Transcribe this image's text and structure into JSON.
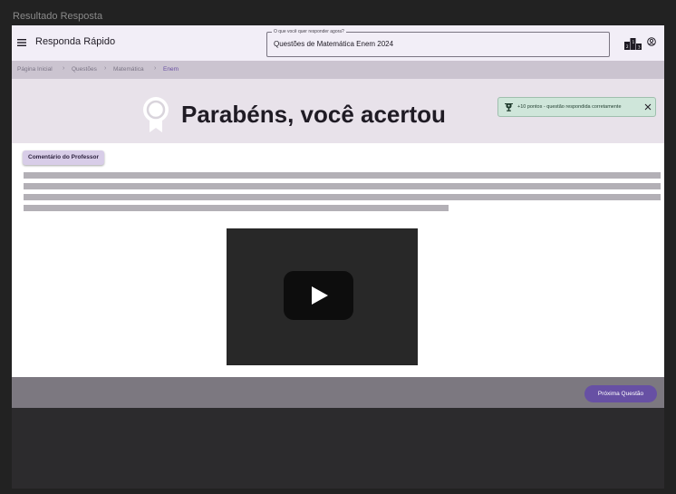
{
  "window": {
    "title": "Resultado Resposta"
  },
  "appbar": {
    "app_name": "Responda Rápido",
    "search": {
      "label": "O que você quer responder agora?",
      "value": "Questões de Matemática Enem 2024"
    }
  },
  "breadcrumb": {
    "items": [
      "Página Inicial",
      "Questões",
      "Matemática",
      "Enem"
    ],
    "separator": "›"
  },
  "hero": {
    "title": "Parabéns, você acertou"
  },
  "notification": {
    "text": "+10 pontos - questão respondida corretamente"
  },
  "content": {
    "teacher_comment_label": "Comentário do Professor",
    "comment_lines_fill": [
      1.0,
      1.0,
      1.0,
      0.67
    ]
  },
  "footer": {
    "next_label": "Próxima Questão"
  },
  "colors": {
    "accent": "#6750a4",
    "hero_bg": "#e8e2ea",
    "breadcrumb_bg": "#cbc4d0",
    "snackbar_bg": "#cfe6da",
    "video_bg": "#282828",
    "footer_bg": "#7c7880"
  },
  "icons": [
    "menu-icon",
    "ranking-podium-icon",
    "account-circle-icon",
    "medal-icon",
    "trophy-icon",
    "close-icon",
    "youtube-play-icon"
  ]
}
